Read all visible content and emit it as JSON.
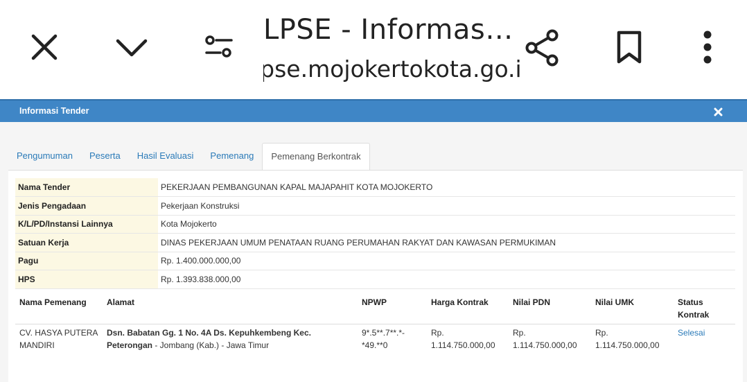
{
  "browser": {
    "title": "LPSE - Informas…",
    "url": "lpse.mojokertokota.go.id",
    "icons": [
      "close-icon",
      "chevron-down-icon",
      "page-settings-icon",
      "share-icon",
      "bookmark-icon",
      "more-vertical-icon"
    ]
  },
  "modal": {
    "title": "Informasi Tender",
    "close_symbol": "✖",
    "header_color": "#3f86c6"
  },
  "tabs": [
    {
      "label": "Pengumuman"
    },
    {
      "label": "Peserta"
    },
    {
      "label": "Hasil Evaluasi"
    },
    {
      "label": "Pemenang"
    },
    {
      "label": "Pemenang Berkontrak",
      "active": true
    }
  ],
  "info": [
    {
      "label": "Nama Tender",
      "value": "PEKERJAAN PEMBANGUNAN KAPAL MAJAPAHIT KOTA MOJOKERTO"
    },
    {
      "label": "Jenis Pengadaan",
      "value": "Pekerjaan Konstruksi"
    },
    {
      "label": "K/L/PD/Instansi Lainnya",
      "value": "Kota Mojokerto"
    },
    {
      "label": "Satuan Kerja",
      "value": "DINAS PEKERJAAN UMUM PENATAAN RUANG PERUMAHAN RAKYAT DAN KAWASAN PERMUKIMAN"
    },
    {
      "label": "Pagu",
      "value": "Rp. 1.400.000.000,00"
    },
    {
      "label": "HPS",
      "value": "Rp. 1.393.838.000,00"
    }
  ],
  "winners": {
    "headers": {
      "nama": "Nama Pemenang",
      "alamat": "Alamat",
      "npwp": "NPWP",
      "harga": "Harga Kontrak",
      "pdn": "Nilai PDN",
      "umk": "Nilai UMK",
      "status_line1": "Status",
      "status_line2": "Kontrak"
    },
    "rows": [
      {
        "nama_line1": "CV. HASYA PUTERA",
        "nama_line2": "MANDIRI",
        "alamat_bold_line1": "Dsn. Babatan Gg. 1 No. 4A Ds. Kepuhkembeng Kec.",
        "alamat_bold_line2": "Peterongan",
        "alamat_rest": " - Jombang (Kab.) - Jawa Timur",
        "npwp_line1": "9*.5**.7**.*-",
        "npwp_line2": "*49.**0",
        "harga_line1": "Rp.",
        "harga_line2": "1.114.750.000,00",
        "pdn_line1": "Rp.",
        "pdn_line2": "1.114.750.000,00",
        "umk_line1": "Rp.",
        "umk_line2": "1.114.750.000,00",
        "status": "Selesai"
      }
    ]
  }
}
